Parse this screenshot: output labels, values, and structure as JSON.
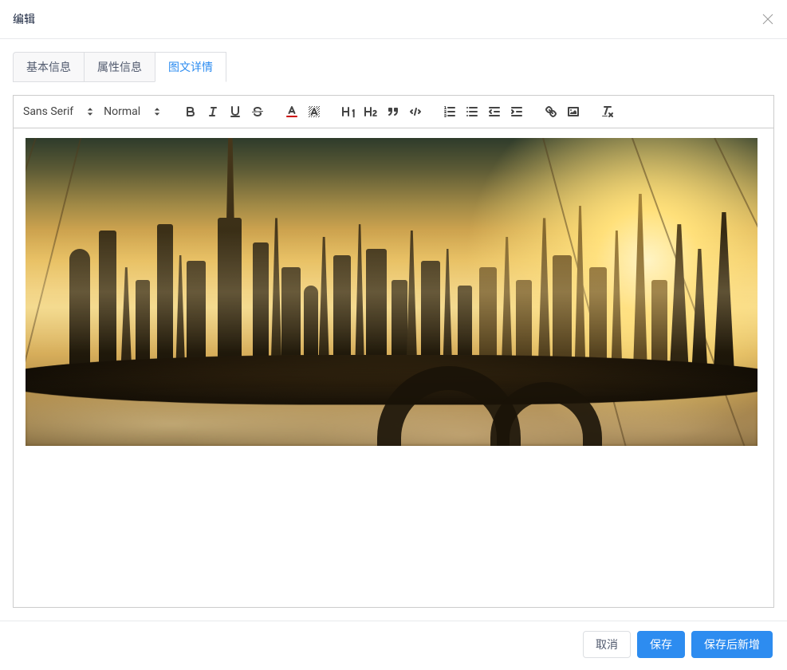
{
  "dialog": {
    "title": "编辑"
  },
  "tabs": [
    {
      "label": "基本信息",
      "active": false
    },
    {
      "label": "属性信息",
      "active": false
    },
    {
      "label": "图文详情",
      "active": true
    }
  ],
  "editor": {
    "toolbar": {
      "font_picker": {
        "label": "Sans Serif"
      },
      "size_picker": {
        "label": "Normal"
      }
    },
    "content_kind": "image",
    "content_description": "golden sci-fi cityscape at sunset on a floating platform"
  },
  "footer": {
    "cancel": "取消",
    "save": "保存",
    "save_and_new": "保存后新增"
  }
}
